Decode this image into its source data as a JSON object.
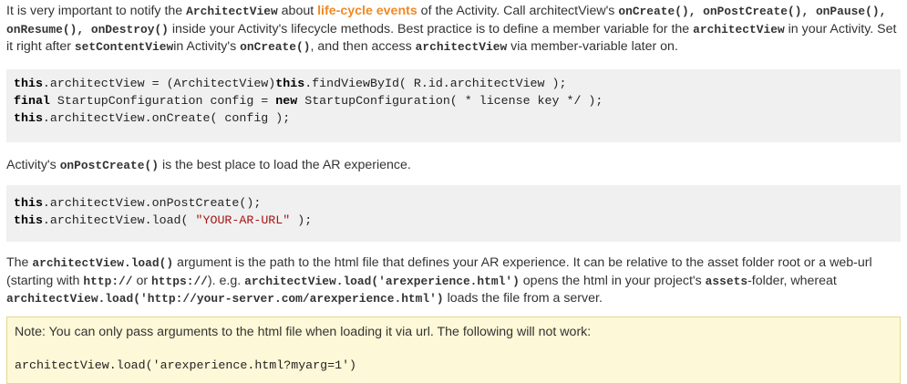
{
  "para1": {
    "t1": "It is very important to notify the ",
    "c1": "ArchitectView",
    "t2": " about ",
    "link": "life-cycle events",
    "t3": " of the Activity. Call architectView's ",
    "c2": "onCreate(), onPostCreate(), onPause(), onResume(), onDestroy()",
    "t4": " inside your Activity's lifecycle methods. Best practice is to define a member variable for the ",
    "c3": "architectView",
    "t5": " in your Activity. Set it right after ",
    "c4": "setContentView",
    "t6": "in Activity's ",
    "c5": "onCreate()",
    "t7": ", and then access ",
    "c6": "architectView",
    "t8": " via member-variable later on."
  },
  "code1": {
    "l1_kw1": "this",
    "l1_a": ".architectView = (ArchitectView)",
    "l1_kw2": "this",
    "l1_b": ".findViewById( R.id.architectView );",
    "l2_kw1": "final",
    "l2_a": " StartupConfiguration config = ",
    "l2_kw2": "new",
    "l2_b": " StartupConfiguration( * license key */ );",
    "l3_kw1": "this",
    "l3_a": ".architectView.onCreate( config );"
  },
  "para2": {
    "t1": "Activity's ",
    "c1": "onPostCreate()",
    "t2": " is the best place to load the AR experience."
  },
  "code2": {
    "l1_kw": "this",
    "l1_a": ".architectView.onPostCreate();",
    "l2_kw": "this",
    "l2_a": ".architectView.load( ",
    "l2_str": "\"YOUR-AR-URL\"",
    "l2_b": " );"
  },
  "para3": {
    "t1": "The ",
    "c1": "architectView.load()",
    "t2": " argument is the path to the html file that defines your AR experience. It can be relative to the asset folder root or a web-url (starting with ",
    "c2": "http://",
    "t3": " or ",
    "c3": "https://",
    "t4": "). e.g. ",
    "c4": "architectView.load('arexperience.html')",
    "t5": " opens the html in your project's ",
    "c5": "assets",
    "t6": "-folder, whereat ",
    "c6": "architectView.load('http://your-server.com/arexperience.html')",
    "t7": " loads the file from a server."
  },
  "note": {
    "text": "Note: You can only pass arguments to the html file when loading it via url. The following will not work:",
    "code": "architectView.load('arexperience.html?myarg=1')"
  }
}
